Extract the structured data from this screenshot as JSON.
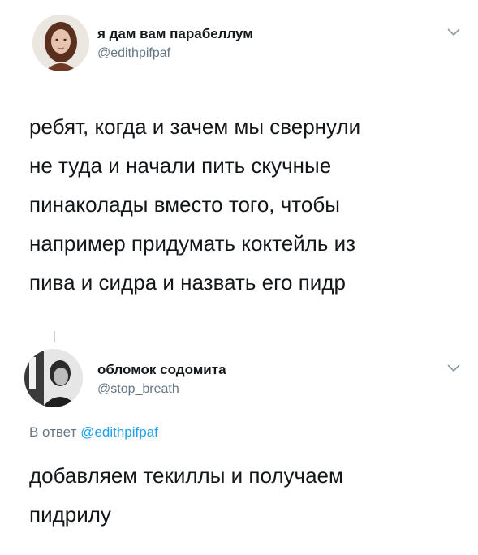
{
  "tweet": {
    "display_name": "я дам вам парабеллум",
    "handle": "@edithpifpaf",
    "text": "ребят, когда и зачем мы свернули\nне туда и начали пить скучные\nпинаколады вместо того, чтобы\nнапример придумать коктейль из\nпива и сидра и назвать его пидр",
    "menu_icon": "chevron-down-icon"
  },
  "reply": {
    "display_name": "обломок содомита",
    "handle": "@stop_breath",
    "reply_prefix": "В ответ",
    "reply_to_handle": "@edithpifpaf",
    "text": "добавляем текиллы и получаем\nпидрилу",
    "menu_icon": "chevron-down-icon"
  },
  "colors": {
    "text": "#14171a",
    "secondary": "#657786",
    "link": "#1da1f2",
    "chevron": "#8899a6"
  }
}
